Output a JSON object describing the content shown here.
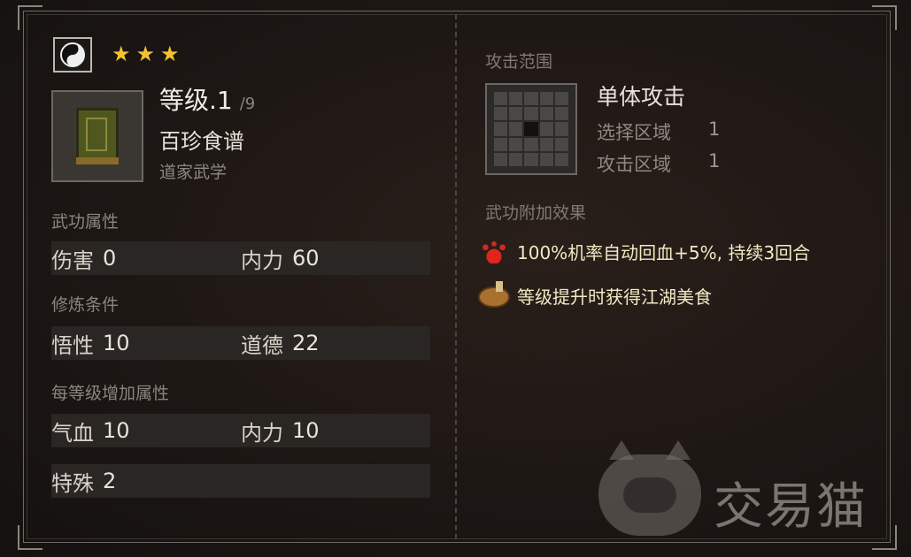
{
  "skill": {
    "type_icon": "yin-yang-icon",
    "stars": 3,
    "level_label": "等级.1",
    "level_max": "/9",
    "name": "百珍食谱",
    "school": "道家武学"
  },
  "attributes": {
    "label": "武功属性",
    "items": [
      {
        "key": "伤害",
        "value": "0"
      },
      {
        "key": "内力",
        "value": "60"
      }
    ]
  },
  "requirements": {
    "label": "修炼条件",
    "items": [
      {
        "key": "悟性",
        "value": "10"
      },
      {
        "key": "道德",
        "value": "22"
      }
    ]
  },
  "per_level": {
    "label": "每等级增加属性",
    "items": [
      {
        "key": "气血",
        "value": "10"
      },
      {
        "key": "内力",
        "value": "10"
      },
      {
        "key": "特殊",
        "value": "2"
      }
    ]
  },
  "attack_range": {
    "label": "攻击范围",
    "type": "单体攻击",
    "select_label": "选择区域",
    "select_value": "1",
    "attack_label": "攻击区域",
    "attack_value": "1"
  },
  "effects": {
    "label": "武功附加效果",
    "items": [
      {
        "icon": "blood-splash-icon",
        "text": "100%机率自动回血+5%, 持续3回合"
      },
      {
        "icon": "roast-food-icon",
        "text": "等级提升时获得江湖美食"
      }
    ]
  },
  "watermark": {
    "text": "交易猫"
  },
  "colors": {
    "star": "#f2c230",
    "effect_text": "#f3e9c4",
    "panel_bg": "#1d1714"
  }
}
